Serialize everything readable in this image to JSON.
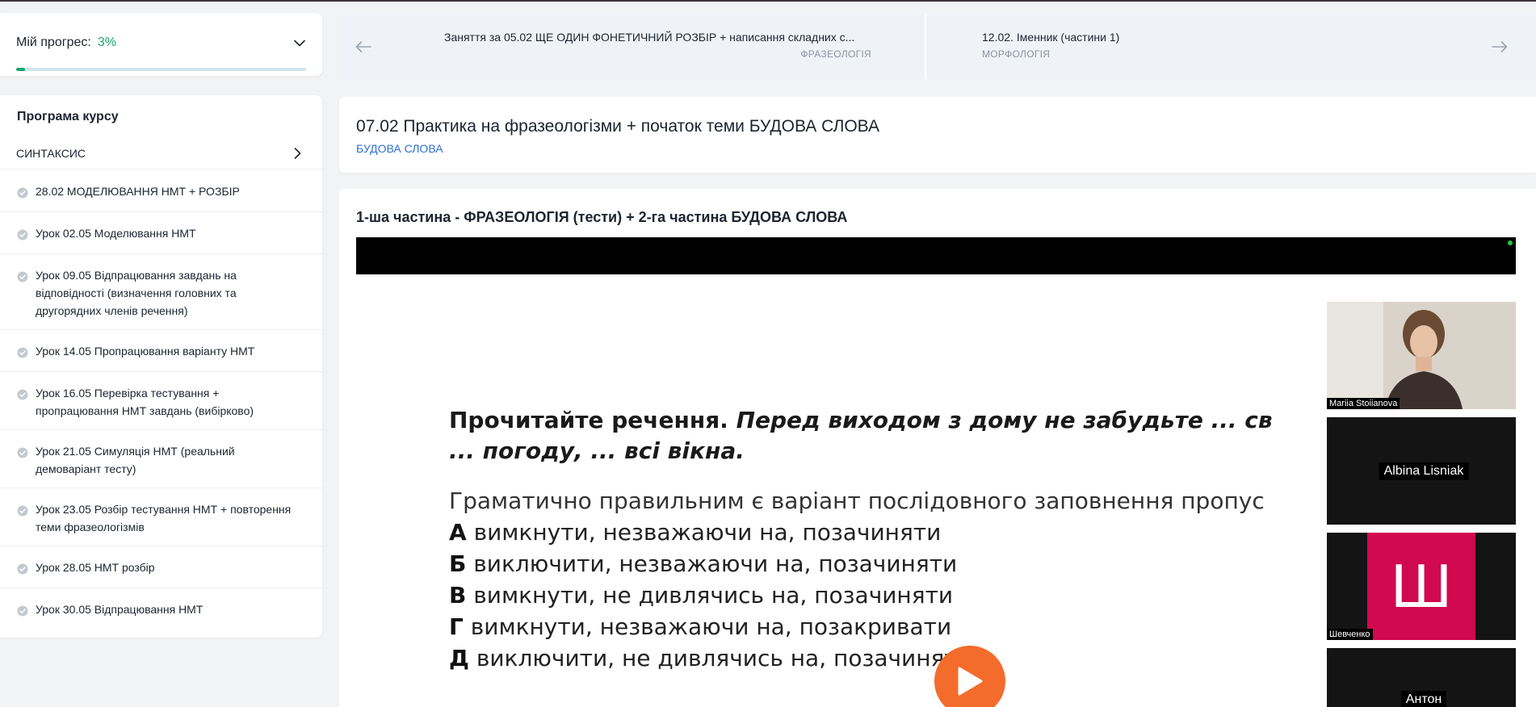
{
  "progress": {
    "label": "Мій прогрес:",
    "value": "3%",
    "fraction": 0.03,
    "accent_color": "#1aa56b",
    "track_color": "#cfe6ef"
  },
  "program": {
    "title": "Програма курсу",
    "section": "СИНТАКСИС",
    "lessons": [
      {
        "title": "28.02 МОДЕЛЮВАННЯ НМТ + РОЗБІР"
      },
      {
        "title": "Урок 02.05 Моделювання НМТ"
      },
      {
        "title": "Урок 09.05 Відпрацювання завдань на відповідності (визначення головних та другорядних членів речення)"
      },
      {
        "title": "Урок 14.05 Пропрацювання варіанту НМТ"
      },
      {
        "title": "Урок 16.05 Перевірка тестування + пропрацювання НМТ завдань (вибірково)"
      },
      {
        "title": "Урок 21.05 Симуляція НМТ (реальний демоваріант тесту)"
      },
      {
        "title": "Урок 23.05 Розбір тестування НМТ + повторення теми фразеологізмів"
      },
      {
        "title": "Урок 28.05 НМТ розбір"
      },
      {
        "title": "Урок 30.05 Відпрацювання НМТ"
      }
    ]
  },
  "navigation": {
    "prev": {
      "title": "Заняття за 05.02 ЩЕ ОДИН ФОНЕТИЧНИЙ РОЗБІР + написання складних с...",
      "topic": "ФРАЗЕОЛОГІЯ"
    },
    "next": {
      "title": "12.02. Іменник (частини 1)",
      "topic": "МОРФОЛОГІЯ"
    }
  },
  "lesson": {
    "title": "07.02 Практика на фразеологізми + початок теми БУДОВА СЛОВА",
    "topic": "БУДОВА СЛОВА",
    "topic_color": "#2f6fd6"
  },
  "video": {
    "heading": "1-ша частина - ФРАЗЕОЛОГІЯ (тести) + 2-га частина БУДОВА СЛОВА",
    "play_color": "#f36c2b",
    "slide": {
      "q_prefix": "Прочитайте речення.",
      "q_line1": "Перед виходом з дому не забудьте ... св",
      "q_line2": "... погоду, ... всі вікна.",
      "intro": "Граматично правильним є варіант послідовного заповнення пропус",
      "options": [
        {
          "letter": "А",
          "text": "вимкнути, незважаючи на, позачиняти"
        },
        {
          "letter": "Б",
          "text": "виключити, незважаючи на, позачиняти"
        },
        {
          "letter": "В",
          "text": "вимкнути, не дивлячись на, позачиняти"
        },
        {
          "letter": "Г",
          "text": "вимкнути, незважаючи на, позакривати"
        },
        {
          "letter": "Д",
          "text": "виключити, не дивлячись на, позачиняти"
        }
      ]
    },
    "participants": [
      {
        "name": "Mariia Stoiianova"
      },
      {
        "name": "Albina Lisniak"
      },
      {
        "name": "Шевченко",
        "avatar_letter": "Ш",
        "avatar_color": "#d1094e"
      },
      {
        "name": "Антон"
      }
    ]
  }
}
